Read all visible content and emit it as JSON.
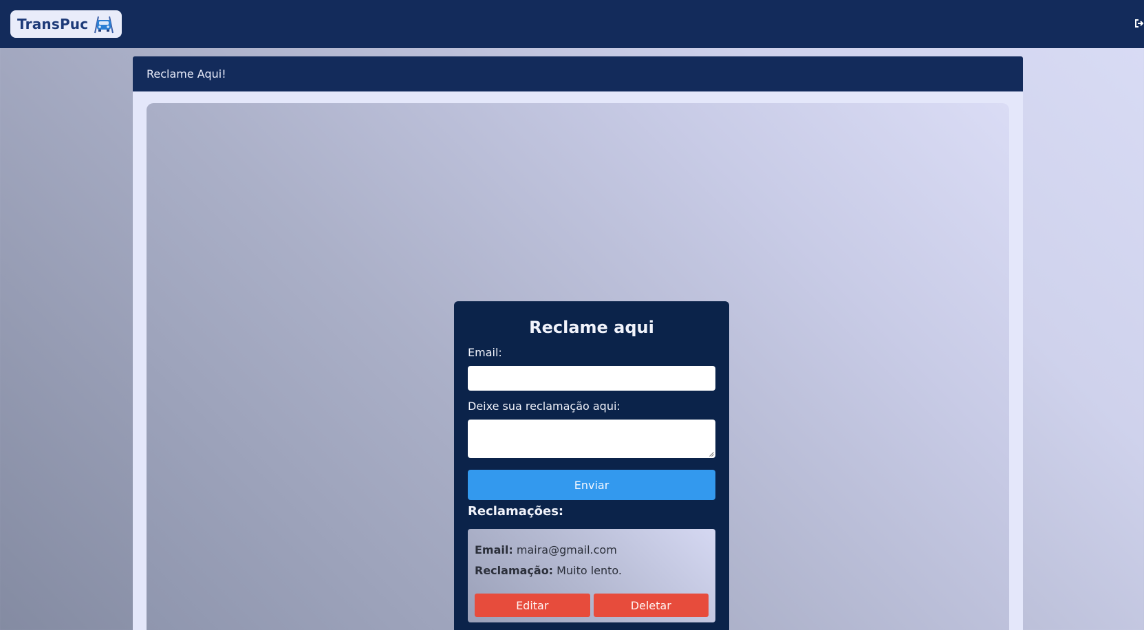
{
  "app": {
    "logo_text": "TransPuc",
    "logo_icon": "car-road-icon",
    "logout_icon": "logout-icon"
  },
  "panel": {
    "title": "Reclame Aqui!"
  },
  "form": {
    "title": "Reclame aqui",
    "email_label": "Email:",
    "email_value": "",
    "complaint_label": "Deixe sua reclamação aqui:",
    "complaint_value": "",
    "submit_label": "Enviar"
  },
  "complaints": {
    "title": "Reclamações:",
    "items": [
      {
        "email_label": "Email:",
        "email": "maira@gmail.com",
        "text_label": "Reclamação:",
        "text": "Muito lento.",
        "edit_label": "Editar",
        "delete_label": "Deletar"
      }
    ]
  },
  "colors": {
    "navbar": "#132b5b",
    "card": "#0b234a",
    "primary_button": "#3399ee",
    "danger_button": "#e74c3c"
  }
}
